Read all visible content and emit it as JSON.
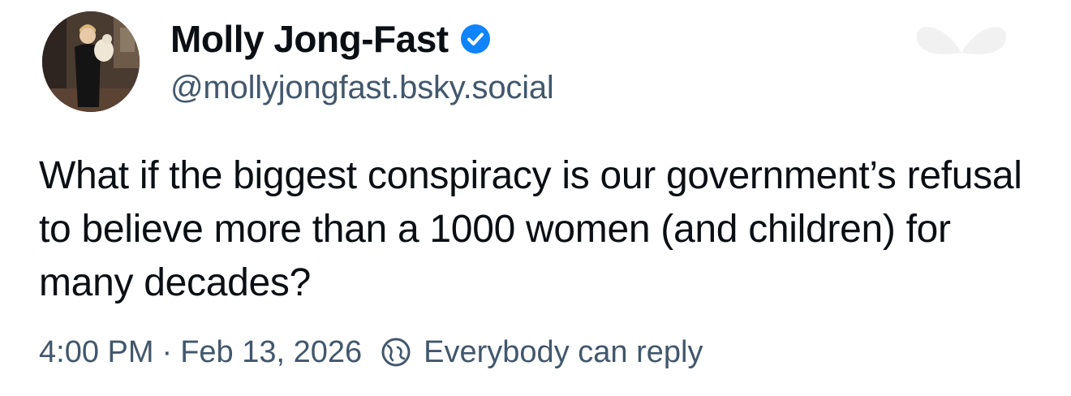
{
  "author": {
    "display_name": "Molly Jong-Fast",
    "handle": "@mollyjongfast.bsky.social",
    "verified": true,
    "verified_icon": "verified-check-icon",
    "avatar_icon": "profile-photo"
  },
  "post": {
    "text": "What if the biggest conspiracy is our government’s refusal to believe more than a 1000 women (and children) for many decades?"
  },
  "meta": {
    "time": "4:00 PM",
    "separator": "·",
    "date": "Feb 13, 2026",
    "reply_setting": "Everybody can reply",
    "reply_icon": "globe-icon"
  },
  "colors": {
    "accent": "#1083fe",
    "muted_text": "#42576c",
    "text": "#0b0f14"
  }
}
